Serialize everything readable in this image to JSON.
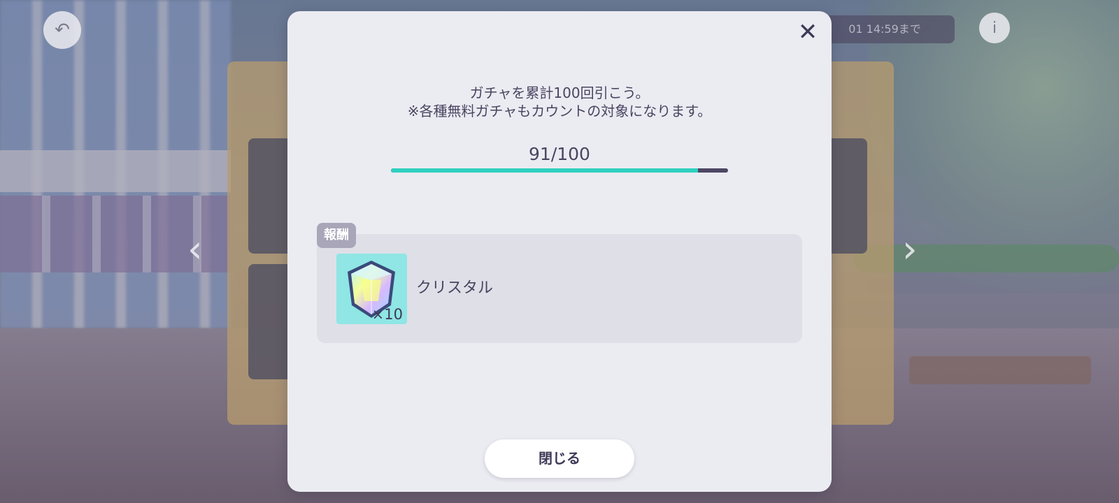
{
  "background": {
    "timer_text": "01 14:59まで",
    "prev_arrow": "‹",
    "next_arrow": "›"
  },
  "modal": {
    "close_icon": "close-icon",
    "mission_line1": "ガチャを累計100回引こう。",
    "mission_line2": "※各種無料ガチャもカウントの対象になります。",
    "progress": {
      "label": "91/100",
      "current": 91,
      "total": 100,
      "fill_color": "#2ed0bf",
      "track_color": "#4d4763"
    },
    "reward": {
      "tag": "報酬",
      "icon": "crystal-icon",
      "quantity": "×10",
      "name": "クリスタル"
    },
    "close_button": "閉じる"
  }
}
